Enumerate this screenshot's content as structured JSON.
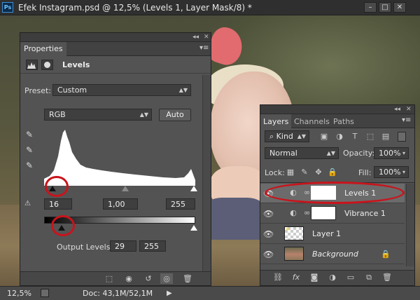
{
  "window": {
    "app_logo": "Ps",
    "title": "Efek Instagram.psd @ 12,5% (Levels 1, Layer Mask/8) *",
    "buttons": [
      "minimize-icon",
      "maximize-icon",
      "close-icon"
    ]
  },
  "properties": {
    "tab_label": "Properties",
    "adjustment_title": "Levels",
    "preset_label": "Preset:",
    "preset_value": "Custom",
    "channel_value": "RGB",
    "auto_label": "Auto",
    "input_levels": {
      "black": "16",
      "gamma": "1,00",
      "white": "255"
    },
    "output_label": "Output Levels:",
    "output_levels": {
      "black": "29",
      "white": "255"
    },
    "footer_icons": [
      "clip-to-layer-icon",
      "view-previous-icon",
      "reset-icon",
      "visibility-icon",
      "trash-icon"
    ]
  },
  "layers": {
    "tabs": [
      "Layers",
      "Channels",
      "Paths"
    ],
    "filter_kind": "Kind",
    "blend_mode": "Normal",
    "opacity_label": "Opacity:",
    "opacity_value": "100%",
    "lock_label": "Lock:",
    "fill_label": "Fill:",
    "fill_value": "100%",
    "items": [
      {
        "name": "Levels 1",
        "type": "adjustment"
      },
      {
        "name": "Vibrance 1",
        "type": "adjustment"
      },
      {
        "name": "Layer 1",
        "type": "pixel"
      },
      {
        "name": "Background",
        "type": "background"
      }
    ],
    "footer_icons": [
      "link-icon",
      "fx-icon",
      "mask-icon",
      "adjustment-icon",
      "folder-icon",
      "new-layer-icon",
      "trash-icon"
    ]
  },
  "status": {
    "zoom": "12,5%",
    "doc": "Doc: 43,1M/52,1M"
  }
}
